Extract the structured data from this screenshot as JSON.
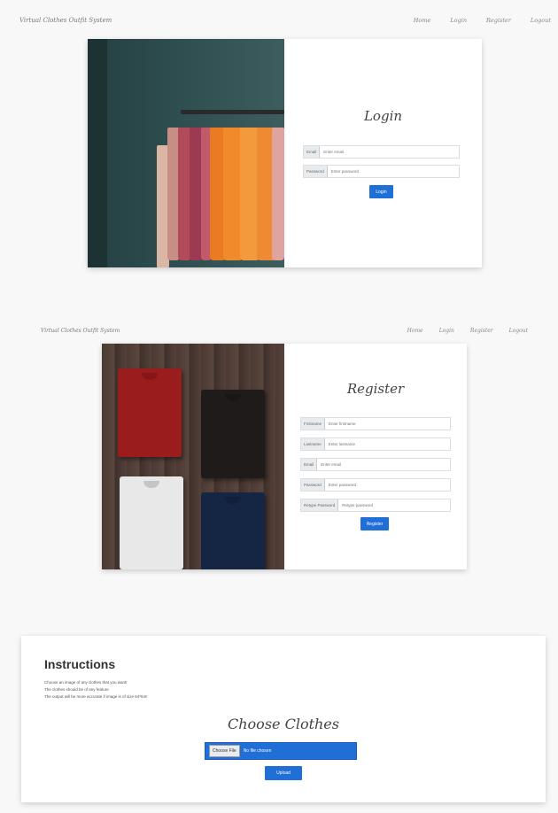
{
  "navbar": {
    "brand": "Virtual Clothes Outfit System",
    "links": [
      "Home",
      "Login",
      "Register",
      "Logout"
    ]
  },
  "login": {
    "title": "Login",
    "fields": [
      {
        "label": "Email",
        "placeholder": "Enter email"
      },
      {
        "label": "Password",
        "placeholder": "Enter password"
      }
    ],
    "submit": "Login"
  },
  "register": {
    "title": "Register",
    "fields": [
      {
        "label": "Firstname",
        "placeholder": "Enter firstname"
      },
      {
        "label": "Lastname",
        "placeholder": "Enter lastname"
      },
      {
        "label": "Email",
        "placeholder": "Enter email"
      },
      {
        "label": "Password",
        "placeholder": "Enter password"
      },
      {
        "label": "Retype Password",
        "placeholder": "Retype password"
      }
    ],
    "submit": "Register"
  },
  "instructions": {
    "title": "Instructions",
    "lines": [
      "Choose an image of any clothes that you want!",
      "The clothes should be of any feature",
      "The output will be more accurate if image is of size 64*64!!"
    ],
    "choose_title": "Choose Clothes",
    "file_button": "Choose File",
    "file_status": "No file chosen",
    "upload": "Upload"
  },
  "colors": {
    "primary": "#1f6fd6",
    "orange": "#f08a2a",
    "red_shirt": "#9b1c1c"
  }
}
